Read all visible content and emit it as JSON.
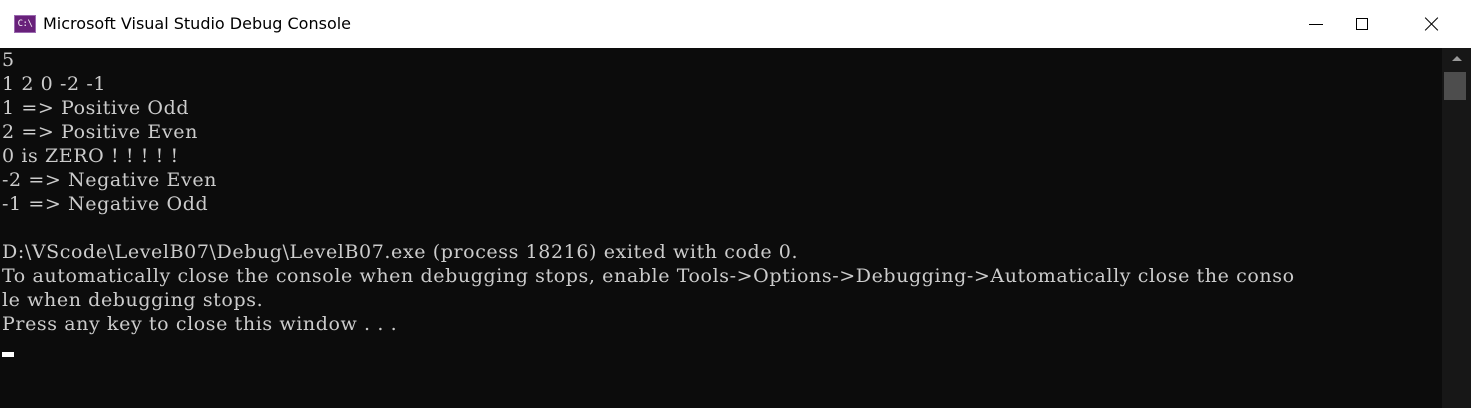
{
  "window": {
    "title": "Microsoft Visual Studio Debug Console",
    "icon_label": "C:\\",
    "controls": {
      "minimize": "minimize-icon",
      "maximize": "maximize-icon",
      "close": "close-icon"
    }
  },
  "colors": {
    "console_bg": "#0c0c0c",
    "console_text": "#cccccc",
    "titlebar_bg": "#ffffff",
    "icon_bg": "#68217a"
  },
  "console": {
    "lines": [
      "5",
      "1 2 0 -2 -1",
      "1 => Positive Odd",
      "2 => Positive Even",
      "0 is ZERO ! ! ! ! !",
      "-2 => Negative Even",
      "-1 => Negative Odd",
      "",
      "D:\\VScode\\LevelB07\\Debug\\LevelB07.exe (process 18216) exited with code 0.",
      "To automatically close the console when debugging stops, enable Tools->Options->Debugging->Automatically close the conso",
      "le when debugging stops.",
      "Press any key to close this window . . ."
    ]
  }
}
